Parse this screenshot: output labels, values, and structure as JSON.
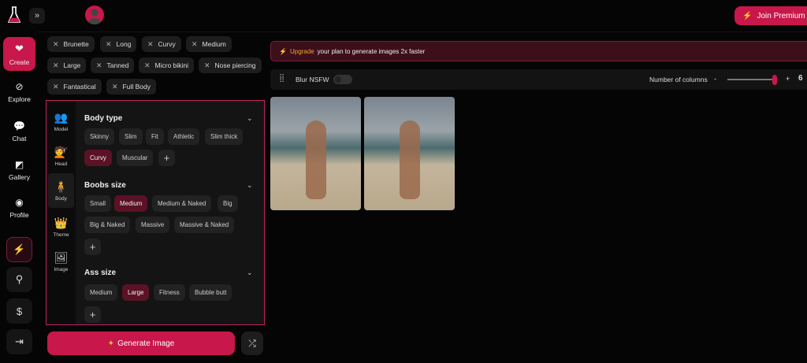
{
  "header": {
    "join_premium": "Join Premium",
    "expand_icon": "»"
  },
  "sidebar": {
    "items": [
      {
        "label": "Create"
      },
      {
        "label": "Explore"
      },
      {
        "label": "Chat"
      },
      {
        "label": "Gallery"
      },
      {
        "label": "Profile"
      }
    ]
  },
  "tags": [
    "Brunette",
    "Long",
    "Curvy",
    "Medium",
    "Large",
    "Tanned",
    "Micro bikini",
    "Nose piercing",
    "Fantastical",
    "Full Body"
  ],
  "panel": {
    "subtabs": [
      "Model",
      "Head",
      "Body",
      "Theme",
      "Image"
    ],
    "sections": [
      {
        "title": "Body type",
        "options": [
          "Skinny",
          "Slim",
          "Fit",
          "Athletic",
          "Slim thick",
          "Curvy",
          "Muscular"
        ],
        "selected": "Curvy"
      },
      {
        "title": "Boobs size",
        "options": [
          "Small",
          "Medium",
          "Medium & Naked",
          "Big",
          "Big & Naked",
          "Massive",
          "Massive & Naked"
        ],
        "selected": "Medium"
      },
      {
        "title": "Ass size",
        "options": [
          "Medium",
          "Large",
          "Fitness",
          "Bubble butt"
        ],
        "selected": "Large"
      }
    ]
  },
  "generate_label": "Generate Image",
  "banner": {
    "link": "Upgrade",
    "text": "your plan to generate images 2x faster"
  },
  "toolbar": {
    "blur_label": "Blur NSFW",
    "blur_on": false,
    "columns_label": "Number of columns",
    "minus": "-",
    "plus": "+",
    "columns_value": "6",
    "columns_fraction": 1.0
  },
  "colors": {
    "accent": "#c8174a",
    "selected": "#5b1226",
    "banner": "#3c0f1b"
  }
}
